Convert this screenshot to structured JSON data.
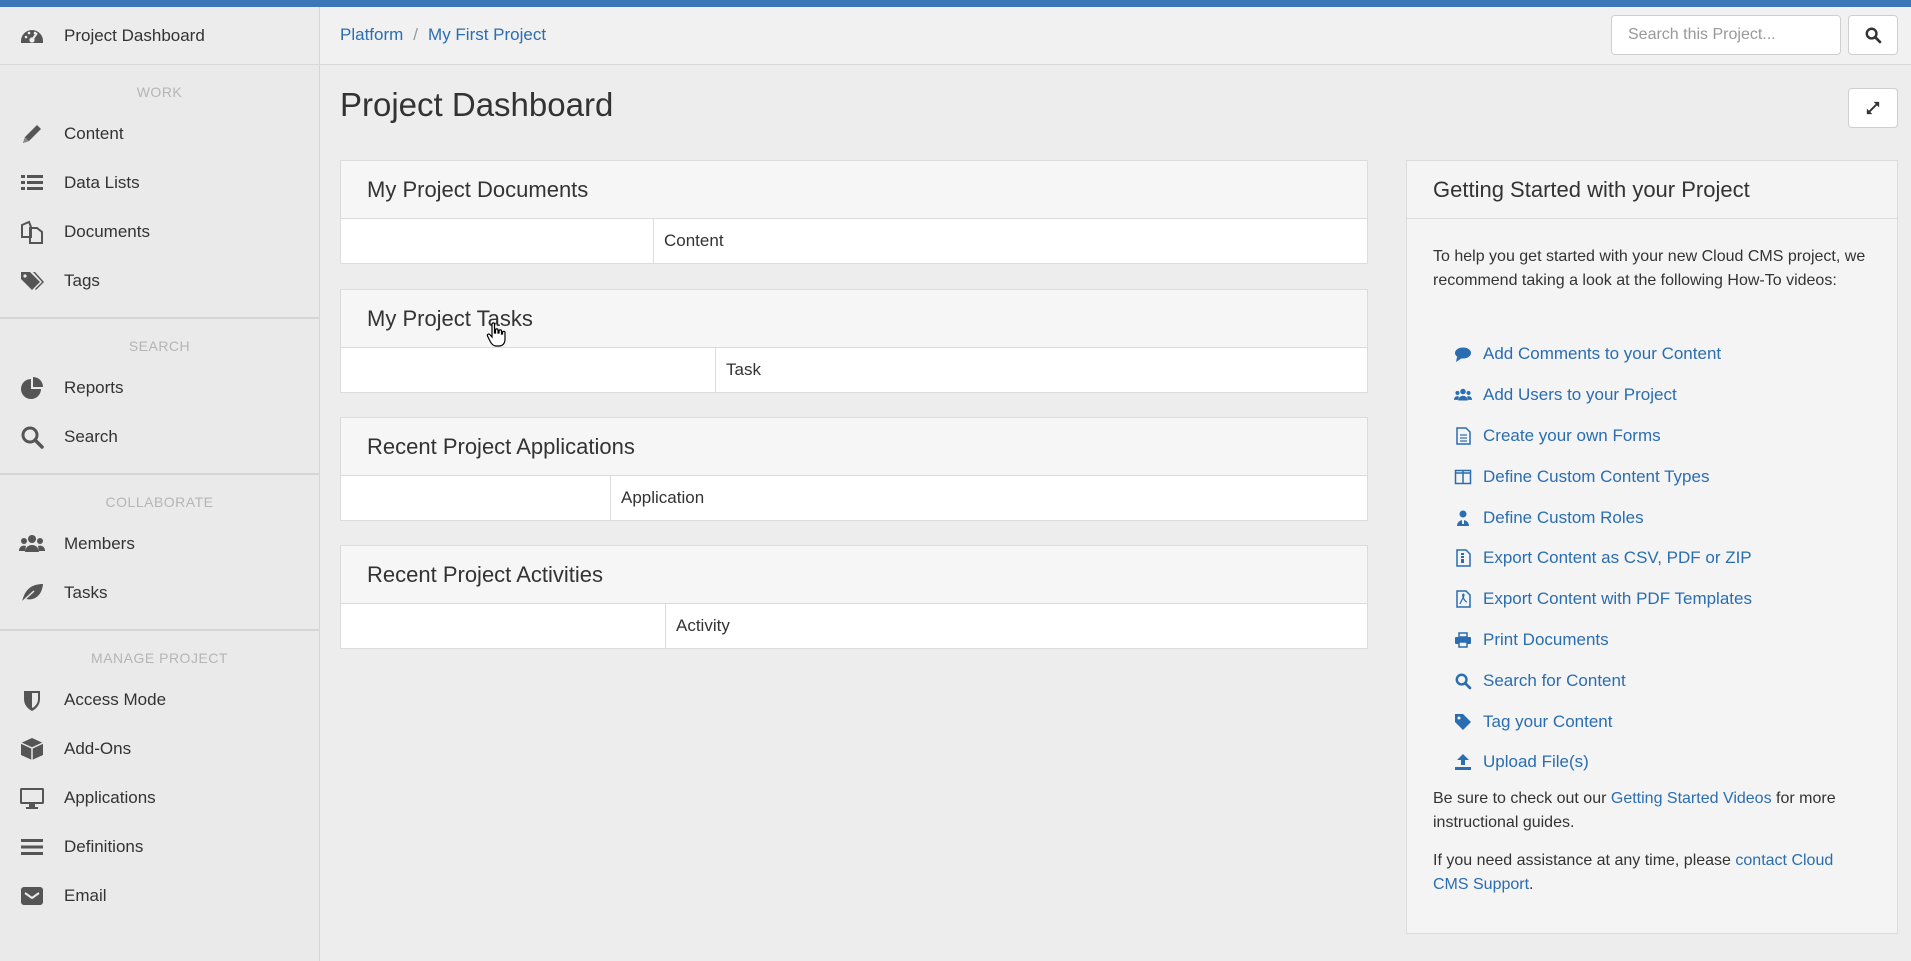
{
  "sidebar": {
    "header_label": "Project Dashboard",
    "sections": [
      {
        "title": "WORK",
        "items": [
          {
            "label": "Content",
            "icon": "pencil-icon"
          },
          {
            "label": "Data Lists",
            "icon": "list-icon"
          },
          {
            "label": "Documents",
            "icon": "documents-icon"
          },
          {
            "label": "Tags",
            "icon": "tags-icon"
          }
        ]
      },
      {
        "title": "SEARCH",
        "items": [
          {
            "label": "Reports",
            "icon": "pie-chart-icon"
          },
          {
            "label": "Search",
            "icon": "search-icon"
          }
        ]
      },
      {
        "title": "COLLABORATE",
        "items": [
          {
            "label": "Members",
            "icon": "users-icon"
          },
          {
            "label": "Tasks",
            "icon": "leaf-icon"
          }
        ]
      },
      {
        "title": "MANAGE PROJECT",
        "items": [
          {
            "label": "Access Mode",
            "icon": "shield-icon"
          },
          {
            "label": "Add-Ons",
            "icon": "box-icon"
          },
          {
            "label": "Applications",
            "icon": "monitor-icon"
          },
          {
            "label": "Definitions",
            "icon": "hamburger-icon"
          },
          {
            "label": "Email",
            "icon": "email-icon"
          }
        ]
      }
    ]
  },
  "header": {
    "breadcrumb": [
      "Platform",
      "My First Project"
    ],
    "breadcrumb_sep": "/",
    "search_placeholder": "Search this Project..."
  },
  "main": {
    "title": "Project Dashboard",
    "panels": [
      {
        "title": "My Project Documents",
        "column": "Content"
      },
      {
        "title": "My Project Tasks",
        "column": "Task"
      },
      {
        "title": "Recent Project Applications",
        "column": "Application"
      },
      {
        "title": "Recent Project Activities",
        "column": "Activity"
      }
    ]
  },
  "getting_started": {
    "title": "Getting Started with your Project",
    "intro": "To help you get started with your new Cloud CMS project, we recommend taking a look at the following How-To videos:",
    "links": [
      {
        "label": "Add Comments to your Content",
        "icon": "comment-icon"
      },
      {
        "label": "Add Users to your Project",
        "icon": "users-icon"
      },
      {
        "label": "Create your own Forms",
        "icon": "form-icon"
      },
      {
        "label": "Define Custom Content Types",
        "icon": "columns-icon"
      },
      {
        "label": "Define Custom Roles",
        "icon": "user-role-icon"
      },
      {
        "label": "Export Content as CSV, PDF or ZIP",
        "icon": "file-zip-icon"
      },
      {
        "label": "Export Content with PDF Templates",
        "icon": "file-pdf-icon"
      },
      {
        "label": "Print Documents",
        "icon": "print-icon"
      },
      {
        "label": "Search for Content",
        "icon": "search-icon"
      },
      {
        "label": "Tag your Content",
        "icon": "tag-icon"
      },
      {
        "label": "Upload File(s)",
        "icon": "upload-icon"
      }
    ],
    "foot1_pre": "Be sure to check out our ",
    "foot1_link": "Getting Started Videos",
    "foot1_post": " for more instructional guides.",
    "foot2_pre": "If you need assistance at any time, please ",
    "foot2_link": "contact Cloud CMS Support",
    "foot2_post": "."
  },
  "colors": {
    "accent": "#3c78b8",
    "link": "#2a6db0"
  }
}
